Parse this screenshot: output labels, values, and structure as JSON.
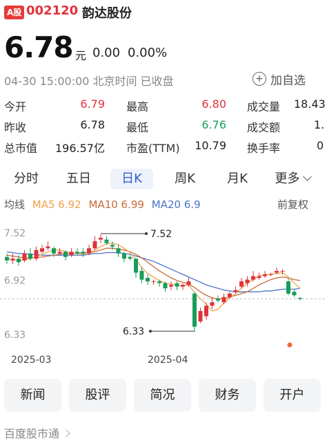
{
  "header": {
    "market_badge": "A股",
    "code": "002120",
    "name": "韵达股份"
  },
  "quote": {
    "price": "6.78",
    "currency": "元",
    "change": "0.00",
    "change_pct": "0.00%",
    "timestamp": "04-30 15:00:00 北京时间 已收盘",
    "add_watch_label": "加自选"
  },
  "stats": {
    "open_label": "今开",
    "open": "6.79",
    "prev_close_label": "昨收",
    "prev_close": "6.78",
    "market_cap_label": "总市值",
    "market_cap": "196.57亿",
    "high_label": "最高",
    "high": "6.80",
    "low_label": "最低",
    "low": "6.76",
    "pe_label": "市盈(TTM)",
    "pe": "10.79",
    "volume_label": "成交量",
    "volume": "18.43",
    "turnover_label": "成交额",
    "turnover": "1.",
    "turnover_rate_label": "换手率",
    "turnover_rate": "0"
  },
  "tabs": [
    {
      "label": "分时"
    },
    {
      "label": "五日"
    },
    {
      "label": "日K",
      "active": true
    },
    {
      "label": "周K"
    },
    {
      "label": "月K"
    },
    {
      "label": "更多"
    }
  ],
  "ma_legend": {
    "prefix": "均线",
    "ma5": "MA5 6.92",
    "ma10": "MA10 6.99",
    "ma20": "MA20 6.9",
    "adjust": "前复权"
  },
  "chart_data": {
    "type": "candlestick",
    "y_ticks": [
      "7.52",
      "6.92",
      "6.33"
    ],
    "x_ticks": [
      "2025-03",
      "2025-04"
    ],
    "annotations": {
      "high": "7.52",
      "low": "6.33"
    },
    "ylim": [
      6.33,
      7.52
    ],
    "candles": [
      [
        7.26,
        7.22,
        7.3,
        7.18
      ],
      [
        7.22,
        7.24,
        7.3,
        7.18
      ],
      [
        7.24,
        7.2,
        7.28,
        7.16
      ],
      [
        7.22,
        7.3,
        7.34,
        7.2
      ],
      [
        7.3,
        7.24,
        7.36,
        7.22
      ],
      [
        7.24,
        7.34,
        7.38,
        7.22
      ],
      [
        7.32,
        7.36,
        7.4,
        7.3
      ],
      [
        7.36,
        7.38,
        7.44,
        7.34
      ],
      [
        7.36,
        7.3,
        7.38,
        7.26
      ],
      [
        7.3,
        7.32,
        7.36,
        7.28
      ],
      [
        7.32,
        7.26,
        7.34,
        7.22
      ],
      [
        7.28,
        7.32,
        7.36,
        7.26
      ],
      [
        7.32,
        7.3,
        7.36,
        7.28
      ],
      [
        7.32,
        7.3,
        7.36,
        7.26
      ],
      [
        7.3,
        7.36,
        7.4,
        7.28
      ],
      [
        7.36,
        7.44,
        7.5,
        7.34
      ],
      [
        7.46,
        7.48,
        7.52,
        7.42
      ],
      [
        7.46,
        7.42,
        7.5,
        7.4
      ],
      [
        7.4,
        7.38,
        7.44,
        7.34
      ],
      [
        7.36,
        7.3,
        7.4,
        7.26
      ],
      [
        7.3,
        7.24,
        7.32,
        7.2
      ],
      [
        7.26,
        7.24,
        7.28,
        7.22
      ],
      [
        7.24,
        7.08,
        7.24,
        7.02
      ],
      [
        7.1,
        7.0,
        7.14,
        6.96
      ],
      [
        7.02,
        6.98,
        7.06,
        6.94
      ],
      [
        6.98,
        6.98,
        7.0,
        6.94
      ],
      [
        6.98,
        6.96,
        7.0,
        6.92
      ],
      [
        6.96,
        6.9,
        6.98,
        6.86
      ],
      [
        6.92,
        6.94,
        6.98,
        6.88
      ],
      [
        6.96,
        6.92,
        6.98,
        6.88
      ],
      [
        6.92,
        6.94,
        6.96,
        6.88
      ],
      [
        6.94,
        6.98,
        7.02,
        6.92
      ],
      [
        6.84,
        6.46,
        6.86,
        6.4
      ],
      [
        6.52,
        6.64,
        6.68,
        6.5
      ],
      [
        6.58,
        6.7,
        6.74,
        6.54
      ],
      [
        6.7,
        6.74,
        6.8,
        6.66
      ],
      [
        6.78,
        6.76,
        6.82,
        6.74
      ],
      [
        6.74,
        6.8,
        6.84,
        6.72
      ],
      [
        6.8,
        6.84,
        6.86,
        6.78
      ],
      [
        6.86,
        6.88,
        6.92,
        6.84
      ],
      [
        6.92,
        6.98,
        7.02,
        6.9
      ],
      [
        6.96,
        7.0,
        7.04,
        6.92
      ],
      [
        7.0,
        7.04,
        7.1,
        6.98
      ],
      [
        7.02,
        7.04,
        7.08,
        7.0
      ],
      [
        7.04,
        7.06,
        7.1,
        7.02
      ],
      [
        7.06,
        7.06,
        7.08,
        7.04
      ],
      [
        7.08,
        7.1,
        7.14,
        7.06
      ],
      [
        7.1,
        7.1,
        7.12,
        7.06
      ],
      [
        6.98,
        6.84,
        7.02,
        6.82
      ],
      [
        6.86,
        6.82,
        6.88,
        6.8
      ],
      [
        6.79,
        6.78,
        6.8,
        6.76
      ]
    ],
    "ma5": [
      7.24,
      7.23,
      7.22,
      7.23,
      7.24,
      7.26,
      7.29,
      7.32,
      7.34,
      7.34,
      7.32,
      7.31,
      7.3,
      7.29,
      7.31,
      7.34,
      7.38,
      7.41,
      7.42,
      7.4,
      7.36,
      7.31,
      7.23,
      7.14,
      7.07,
      7.03,
      6.99,
      6.96,
      6.95,
      6.94,
      6.93,
      6.94,
      6.85,
      6.78,
      6.72,
      6.64,
      6.66,
      6.73,
      6.79,
      6.84,
      6.9,
      6.96,
      7.0,
      7.04,
      7.06,
      7.06,
      7.07,
      7.08,
      7.03,
      6.96,
      6.9
    ],
    "ma10": [
      7.28,
      7.27,
      7.26,
      7.25,
      7.25,
      7.25,
      7.26,
      7.27,
      7.28,
      7.29,
      7.3,
      7.3,
      7.3,
      7.31,
      7.31,
      7.32,
      7.34,
      7.36,
      7.36,
      7.35,
      7.34,
      7.32,
      7.29,
      7.25,
      7.2,
      7.15,
      7.1,
      7.06,
      7.02,
      6.99,
      6.97,
      6.95,
      6.91,
      6.86,
      6.82,
      6.79,
      6.78,
      6.78,
      6.8,
      6.82,
      6.84,
      6.86,
      6.9,
      6.94,
      6.97,
      7.0,
      7.02,
      7.03,
      7.02,
      7.0,
      6.99
    ],
    "ma20": [
      7.32,
      7.31,
      7.3,
      7.3,
      7.29,
      7.29,
      7.28,
      7.28,
      7.28,
      7.28,
      7.28,
      7.28,
      7.28,
      7.28,
      7.29,
      7.3,
      7.3,
      7.31,
      7.31,
      7.31,
      7.3,
      7.29,
      7.27,
      7.25,
      7.23,
      7.21,
      7.18,
      7.15,
      7.12,
      7.09,
      7.06,
      7.03,
      7.0,
      6.97,
      6.94,
      6.92,
      6.9,
      6.88,
      6.87,
      6.86,
      6.86,
      6.86,
      6.86,
      6.86,
      6.87,
      6.87,
      6.88,
      6.89,
      6.89,
      6.89,
      6.9
    ],
    "colors": {
      "up": "#e0323a",
      "down": "#1a9c5a",
      "ma5": "#f0a24a",
      "ma10": "#c86a3a",
      "ma20": "#4a74c9"
    }
  },
  "actions": [
    {
      "label": "新闻"
    },
    {
      "label": "股评"
    },
    {
      "label": "简况"
    },
    {
      "label": "财务"
    },
    {
      "label": "开户"
    }
  ],
  "footer": {
    "link": "百度股市通"
  }
}
